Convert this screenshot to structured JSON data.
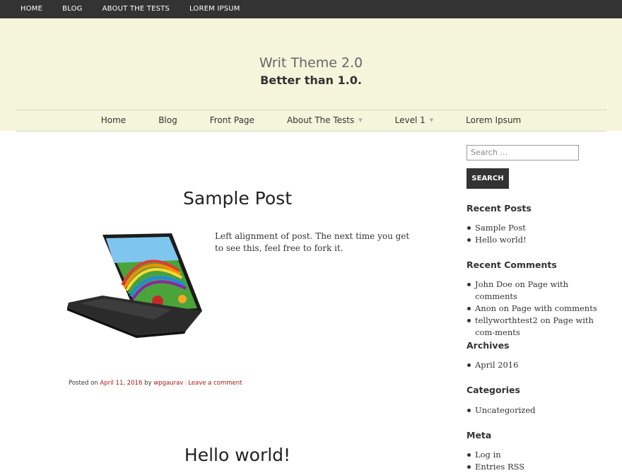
{
  "topbar": {
    "items": [
      "HOME",
      "BLOG",
      "ABOUT THE TESTS",
      "LOREM IPSUM"
    ]
  },
  "header": {
    "title": "Writ Theme 2.0",
    "description": "Better than 1.0.",
    "nav": [
      {
        "label": "Home"
      },
      {
        "label": "Blog"
      },
      {
        "label": "Front Page"
      },
      {
        "label": "About The Tests",
        "submenu_indicator": "▼"
      },
      {
        "label": "Level 1",
        "submenu_indicator": "▼"
      },
      {
        "label": "Lorem Ipsum"
      }
    ]
  },
  "posts": [
    {
      "title": "Sample Post",
      "excerpt": "Left alignment of post. The next time you get to see this, feel free to fork it.",
      "meta": {
        "posted_on_label": "Posted on",
        "date": "April 11, 2016",
        "by_label": "by",
        "author": "wpgaurav",
        "separator": "|",
        "comment_link": "Leave a comment"
      }
    },
    {
      "title": "Hello world!"
    }
  ],
  "sidebar": {
    "search": {
      "placeholder": "Search …",
      "button": "SEARCH"
    },
    "recent_posts": {
      "title": "Recent Posts",
      "items": [
        "Sample Post",
        "Hello world!"
      ]
    },
    "recent_comments": {
      "title": "Recent Comments",
      "items": [
        {
          "author": "John Doe",
          "on": "on",
          "post": "Page with comments"
        },
        {
          "author": "Anon",
          "on": "on",
          "post": "Page with comments"
        },
        {
          "author": "tellyworthtest2",
          "on": "on",
          "post": "Page with com-ments"
        }
      ]
    },
    "archives": {
      "title": "Archives",
      "items": [
        "April 2016"
      ]
    },
    "categories": {
      "title": "Categories",
      "items": [
        "Uncategorized"
      ]
    },
    "meta": {
      "title": "Meta",
      "items": [
        "Log in",
        "Entries RSS"
      ]
    }
  },
  "colors": {
    "topbar_bg": "#333333",
    "header_bg": "#f5f5dc",
    "link_accent": "#a81818",
    "button_bg": "#333333"
  }
}
